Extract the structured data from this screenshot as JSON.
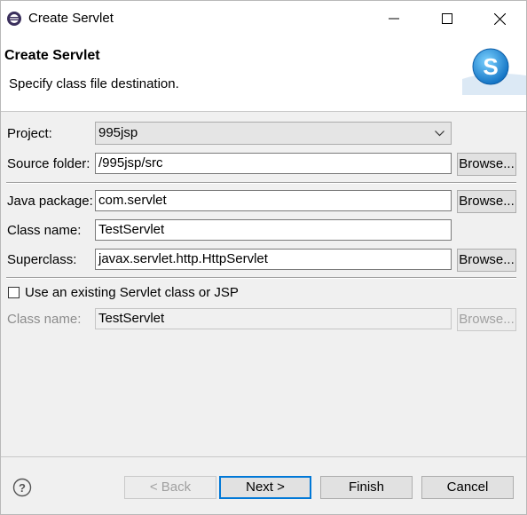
{
  "window": {
    "title": "Create Servlet"
  },
  "header": {
    "title": "Create Servlet",
    "subtitle": "Specify class file destination."
  },
  "form": {
    "project_label": "Project:",
    "project_value": "995jsp",
    "source_folder_label": "Source folder:",
    "source_folder_value": "/995jsp/src",
    "java_package_label": "Java package:",
    "java_package_value": "com.servlet",
    "class_name_label": "Class name:",
    "class_name_value": "TestServlet",
    "superclass_label": "Superclass:",
    "superclass_value": "javax.servlet.http.HttpServlet",
    "browse_label": "Browse...",
    "existing_checkbox_label": "Use an existing Servlet class or JSP",
    "existing_checked": false,
    "existing_class_name_label": "Class name:",
    "existing_class_name_value": "TestServlet"
  },
  "footer": {
    "back_label": "< Back",
    "next_label": "Next >",
    "finish_label": "Finish",
    "cancel_label": "Cancel"
  },
  "colors": {
    "accent": "#0078d7",
    "logo_blue": "#1e8fd8"
  }
}
